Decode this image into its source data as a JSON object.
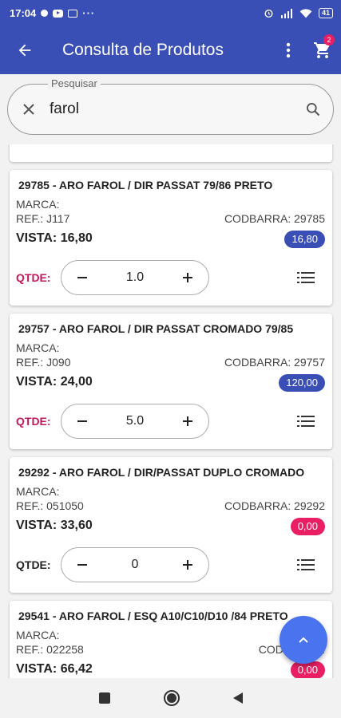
{
  "status_bar": {
    "time": "17:04",
    "battery": "41"
  },
  "app_bar": {
    "title": "Consulta de Produtos",
    "cart_count": "2"
  },
  "search": {
    "legend": "Pesquisar",
    "value": "farol"
  },
  "products": [
    {
      "name": "29785 - ARO FAROL / DIR PASSAT 79/86  PRETO",
      "marca": "MARCA:",
      "ref": "REF.: J117",
      "codbarra": "CODBARRA:  29785",
      "vista": "VISTA: 16,80",
      "badge": "16,80",
      "qtde_label": "QTDE:",
      "qty": "1.0"
    },
    {
      "name": "29757 - ARO FAROL / DIR PASSAT CROMADO 79/85",
      "marca": "MARCA:",
      "ref": "REF.: J090",
      "codbarra": "CODBARRA:  29757",
      "vista": "VISTA: 24,00",
      "badge": "120,00",
      "qtde_label": "QTDE:",
      "qty": "5.0"
    },
    {
      "name": "29292 - ARO FAROL / DIR/PASSAT DUPLO CROMADO",
      "marca": "MARCA:",
      "ref": "REF.: 051050",
      "codbarra": "CODBARRA:  29292",
      "vista": "VISTA: 33,60",
      "badge": "0,00",
      "qtde_label": "QTDE:",
      "qty": "0"
    },
    {
      "name": "29541 - ARO FAROL / ESQ A10/C10/D10 /84 PRETO",
      "marca": "MARCA:",
      "ref": "REF.: 022258",
      "codbarra": "CODBARRA:",
      "vista": "VISTA: 66,42",
      "badge": "0,00"
    }
  ],
  "colors": {
    "primary": "#3a4fb5",
    "accent_pink": "#e91e63",
    "fab": "#4a73f0"
  },
  "icons": {
    "back": "arrow-back-icon",
    "menu": "more-vert-icon",
    "cart": "shopping-cart-icon",
    "clear": "close-icon",
    "search": "search-icon",
    "list": "list-icon",
    "fab": "chevron-up-icon"
  }
}
